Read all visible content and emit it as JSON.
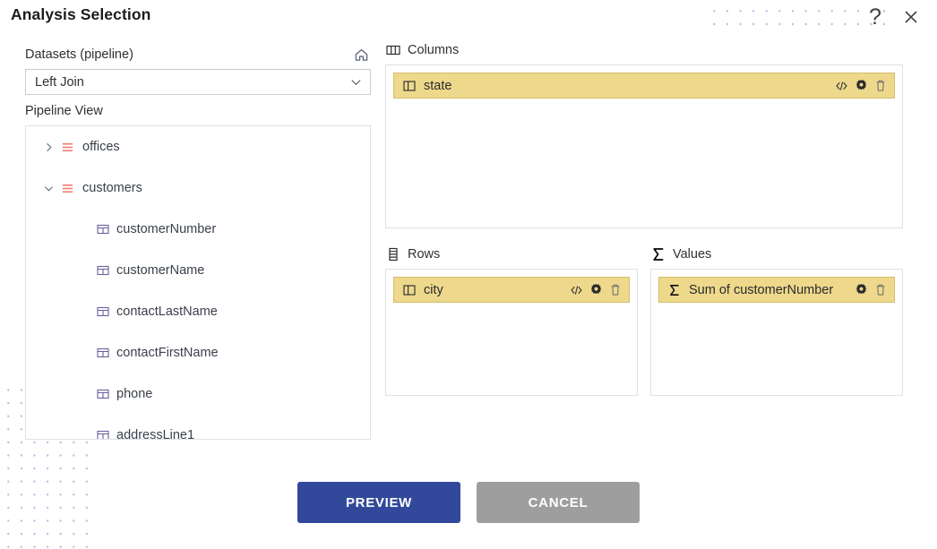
{
  "dialog": {
    "title": "Analysis Selection",
    "help_icon": "question-mark-icon",
    "close_icon": "close-icon"
  },
  "left_panel": {
    "datasets_label": "Datasets (pipeline)",
    "home_icon": "home-icon",
    "pipeline_select": {
      "value": "Left Join",
      "placeholder": "Left Join",
      "chevron_icon": "chevron-down-icon",
      "options": [
        "Left Join"
      ]
    },
    "pipeline_view_label": "Pipeline View",
    "tree": [
      {
        "label": "offices",
        "type": "dataset",
        "icon": "dataset-lines-icon",
        "expanded": false,
        "twisty": "›"
      },
      {
        "label": "customers",
        "type": "dataset",
        "icon": "dataset-lines-icon",
        "expanded": true,
        "twisty": "∨"
      },
      {
        "label": "customerNumber",
        "type": "field",
        "icon": "table-column-icon"
      },
      {
        "label": "customerName",
        "type": "field",
        "icon": "table-column-icon"
      },
      {
        "label": "contactLastName",
        "type": "field",
        "icon": "table-column-icon"
      },
      {
        "label": "contactFirstName",
        "type": "field",
        "icon": "table-column-icon"
      },
      {
        "label": "phone",
        "type": "field",
        "icon": "table-column-icon"
      },
      {
        "label": "addressLine1",
        "type": "field",
        "icon": "table-column-icon"
      }
    ]
  },
  "columns_panel": {
    "header": "Columns",
    "header_icon": "columns-icon",
    "chips": [
      {
        "label": "state",
        "icon": "column-icon",
        "actions": [
          "code-icon",
          "gear-icon",
          "trash-icon"
        ]
      }
    ]
  },
  "rows_panel": {
    "header": "Rows",
    "header_icon": "rows-icon",
    "chips": [
      {
        "label": "city",
        "icon": "column-icon",
        "actions": [
          "code-icon",
          "gear-icon",
          "trash-icon"
        ]
      }
    ]
  },
  "values_panel": {
    "header": "Values",
    "header_icon": "sigma-icon",
    "chips": [
      {
        "label": "Sum of customerNumber",
        "icon": "sigma-icon",
        "actions": [
          "gear-icon",
          "trash-icon"
        ]
      }
    ]
  },
  "footer": {
    "preview_label": "PREVIEW",
    "cancel_label": "CANCEL"
  },
  "colors": {
    "primary": "#32499b",
    "cancel": "#9e9e9e",
    "chip_fill": "#edd88c",
    "chip_border": "#d6bd6a",
    "dataset_icon": "#f4756b",
    "dot_pattern": "#b9bbe0"
  }
}
